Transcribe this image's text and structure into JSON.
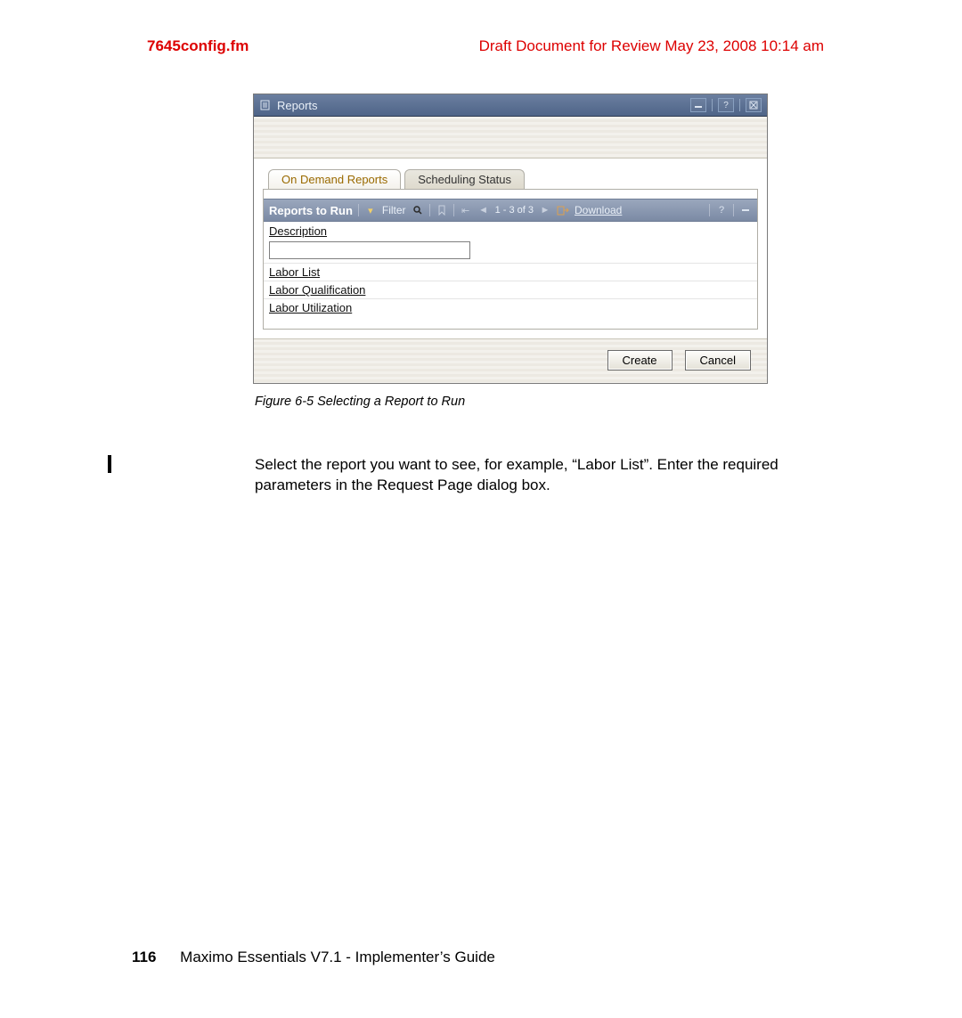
{
  "header": {
    "left": "7645config.fm",
    "right": "Draft Document for Review May 23, 2008 10:14 am"
  },
  "window": {
    "title": "Reports",
    "tabs": [
      {
        "label": "On Demand Reports",
        "active": true
      },
      {
        "label": "Scheduling Status",
        "active": false
      }
    ],
    "toolbar": {
      "title": "Reports to Run",
      "filter_label": "Filter",
      "pager": "1 - 3 of 3",
      "download_label": "Download"
    },
    "column_header": "Description",
    "rows": [
      "Labor List",
      "Labor Qualification",
      "Labor Utilization"
    ],
    "buttons": {
      "create": "Create",
      "cancel": "Cancel"
    }
  },
  "caption": "Figure 6-5   Selecting a Report to Run",
  "body_paragraph": "Select the report you want to see, for example, “Labor List”. Enter the required parameters in the Request Page dialog box.",
  "footer": {
    "page_number": "116",
    "book_title": "Maximo Essentials V7.1 - Implementer’s Guide"
  }
}
